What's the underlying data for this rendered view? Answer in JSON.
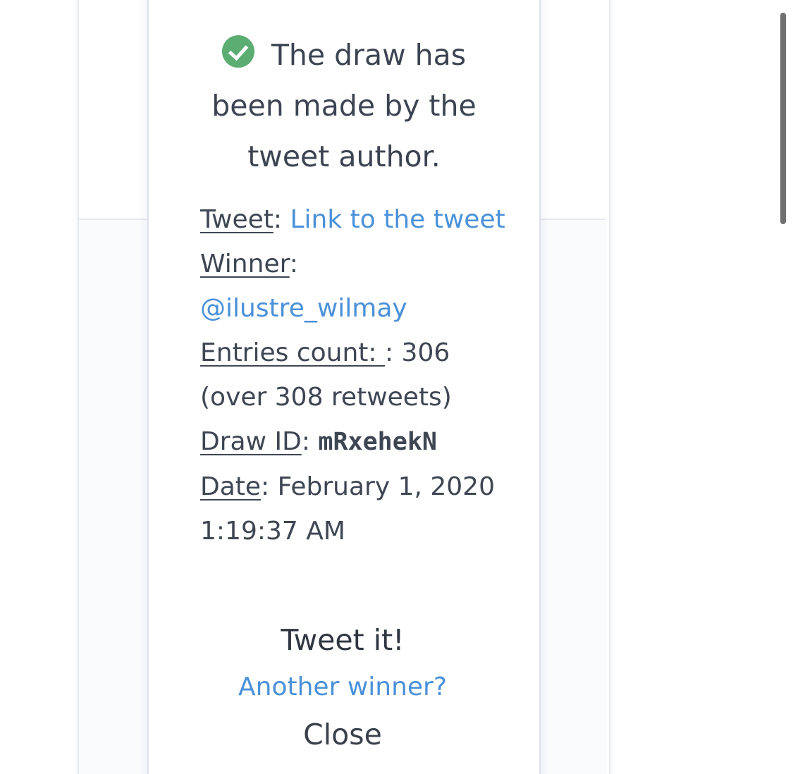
{
  "headline": "The draw has been made by the tweet author.",
  "icons": {
    "status": "check-circle-icon"
  },
  "colors": {
    "success": "#5cad72",
    "link": "#4a90d9",
    "text": "#3e4653"
  },
  "details": {
    "tweet_label": "Tweet",
    "tweet_link": "Link to the tweet",
    "winner_label": "Winner",
    "winner_handle": "@ilustre_wilmay",
    "entries_label": "Entries count: ",
    "entries_value": ": 306 (over 308 retweets)",
    "draw_id_label": "Draw ID",
    "draw_id_value": "mRxehekN",
    "date_label": "Date",
    "date_value": ": February 1, 2020 1:19:37 AM"
  },
  "actions": {
    "tweet_it": "Tweet it!",
    "another_winner": "Another winner?",
    "close": "Close"
  }
}
